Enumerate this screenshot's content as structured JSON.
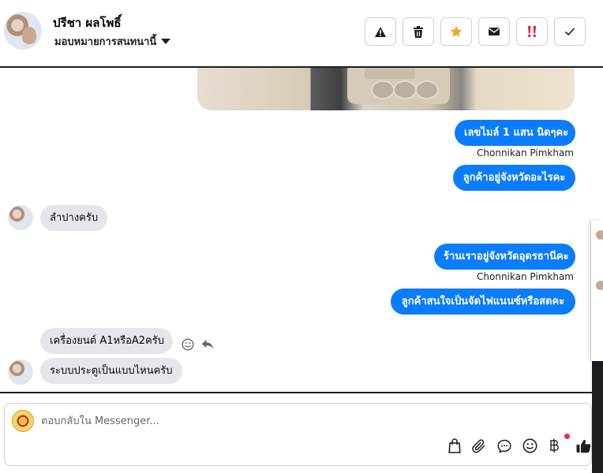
{
  "header": {
    "contact_name": "ปรีชา ผลโพธิ์",
    "assign_label": "มอบหมายการสนทนานี้",
    "buttons": [
      {
        "icon": "warning-icon"
      },
      {
        "icon": "trash-icon"
      },
      {
        "icon": "star-icon",
        "color": "#f5a623"
      },
      {
        "icon": "envelope-icon"
      },
      {
        "icon": "urgent-icon",
        "color": "#e41e3f"
      },
      {
        "icon": "check-icon"
      }
    ]
  },
  "messages": [
    {
      "side": "out",
      "text": "เลขไมล์ 1 แสน นิดๆคะ"
    },
    {
      "side": "out",
      "sender": "Chonnikan Pimkham",
      "text": "ลูกค้าอยู่จังหวัดอะไรคะ"
    },
    {
      "side": "in",
      "text": "ลำปางครับ"
    },
    {
      "side": "out",
      "text": "ร้านเราอยู่จังหวัดอุดรธานีคะ"
    },
    {
      "side": "out",
      "sender": "Chonnikan Pimkham",
      "text": "ลูกค้าสนใจเป็นจัดไฟแนนซ์หรือสดคะ"
    },
    {
      "side": "in",
      "text": "เครื่องยนต์ A1หรือA2ครับ"
    },
    {
      "side": "in",
      "text": "ระบบประตูเป็นแบบไหนครับ"
    }
  ],
  "composer": {
    "placeholder": "ตอบกลับใน Messenger...",
    "icons": [
      "shopping-bag-icon",
      "paperclip-icon",
      "chat-bubble-icon",
      "emoji-icon",
      "baht-icon",
      "thumbs-up-icon"
    ]
  },
  "colors": {
    "outgoing_bubble": "#0a7cff",
    "incoming_bubble": "#e4e6eb",
    "notification_dot": "#f02849"
  }
}
